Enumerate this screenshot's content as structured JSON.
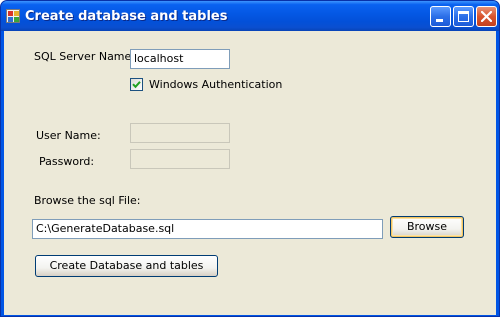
{
  "window": {
    "title": "Create database and tables",
    "icon": "database-app-icon",
    "controls": [
      "minimize-icon",
      "maximize-icon",
      "close-icon"
    ]
  },
  "form": {
    "server_label": "SQL Server Name:",
    "server_value": "localhost",
    "windows_auth_label": "Windows Authentication",
    "windows_auth_checked": true,
    "username_label": "User Name:",
    "username_value": "",
    "password_label": "Password:",
    "password_value": "",
    "browse_label": "Browse the sql File:",
    "file_path": "C:\\GenerateDatabase.sql",
    "browse_button": "Browse",
    "create_button": "Create Database and tables"
  },
  "colors": {
    "titlebar": "#0055e5",
    "client_bg": "#ece9d8",
    "textbox_border": "#7f9db9",
    "check_color": "#21a121"
  }
}
